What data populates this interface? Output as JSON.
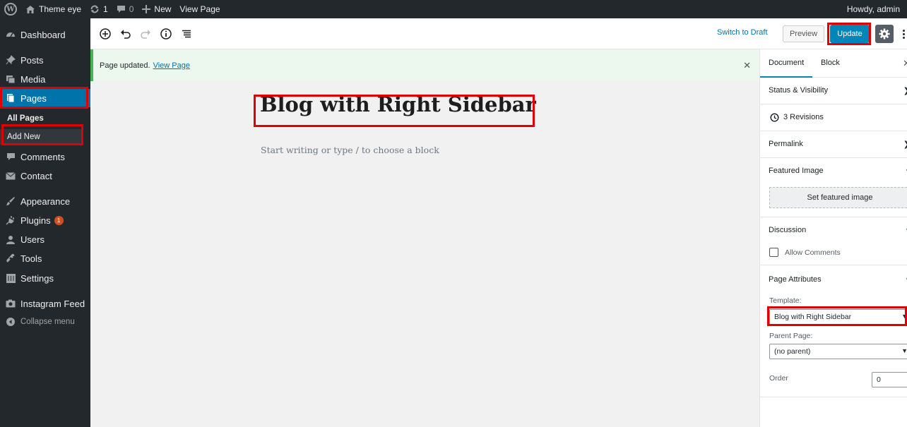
{
  "adminbar": {
    "site_name": "Theme eye",
    "updates_count": "1",
    "comments_count": "0",
    "new_label": "New",
    "view_page_label": "View Page",
    "howdy": "Howdy, admin"
  },
  "menu": {
    "dashboard": "Dashboard",
    "posts": "Posts",
    "media": "Media",
    "pages": "Pages",
    "all_pages": "All Pages",
    "add_new": "Add New",
    "comments": "Comments",
    "contact": "Contact",
    "appearance": "Appearance",
    "plugins": "Plugins",
    "plugins_badge": "1",
    "users": "Users",
    "tools": "Tools",
    "settings": "Settings",
    "instagram_feed": "Instagram Feed",
    "collapse": "Collapse menu"
  },
  "toolbar": {
    "switch_to_draft": "Switch to Draft",
    "preview": "Preview",
    "update": "Update"
  },
  "notice": {
    "text": "Page updated.",
    "link": "View Page"
  },
  "editor": {
    "title": "Blog with Right Sidebar",
    "placeholder": "Start writing or type / to choose a block"
  },
  "sidebar": {
    "tab_document": "Document",
    "tab_block": "Block",
    "status_visibility": "Status & Visibility",
    "revisions": "3 Revisions",
    "permalink": "Permalink",
    "featured_image": "Featured Image",
    "set_featured_image": "Set featured image",
    "discussion": "Discussion",
    "allow_comments": "Allow Comments",
    "page_attributes": "Page Attributes",
    "template_label": "Template:",
    "template_value": "Blog with Right Sidebar",
    "parent_label": "Parent Page:",
    "parent_value": "(no parent)",
    "order_label": "Order",
    "order_value": "0"
  },
  "colors": {
    "admin_dark": "#23282d",
    "accent_blue": "#0073aa",
    "highlight_red": "#e00000",
    "notice_green": "#46b450"
  }
}
